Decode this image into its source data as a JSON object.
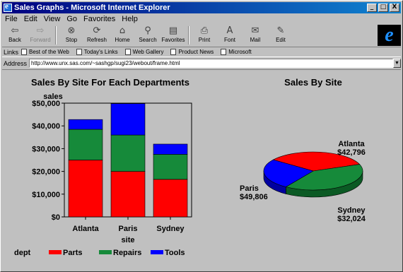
{
  "window": {
    "title": "Sales Graphs - Microsoft Internet Explorer",
    "minimize": "_",
    "maximize": "□",
    "close": "X"
  },
  "menu": [
    "File",
    "Edit",
    "View",
    "Go",
    "Favorites",
    "Help"
  ],
  "menu_access": [
    "F",
    "E",
    "V",
    "G",
    "a",
    "H"
  ],
  "toolbar": [
    {
      "label": "Back",
      "icon": "back-arrow-icon",
      "glyph": "⇦",
      "enabled": true
    },
    {
      "label": "Forward",
      "icon": "forward-arrow-icon",
      "glyph": "⇨",
      "enabled": false
    },
    {
      "label": "Stop",
      "icon": "stop-icon",
      "glyph": "⊗",
      "enabled": true
    },
    {
      "label": "Refresh",
      "icon": "refresh-icon",
      "glyph": "⟳",
      "enabled": true
    },
    {
      "label": "Home",
      "icon": "home-icon",
      "glyph": "⌂",
      "enabled": true
    },
    {
      "label": "Search",
      "icon": "search-icon",
      "glyph": "⚲",
      "enabled": true
    },
    {
      "label": "Favorites",
      "icon": "favorites-icon",
      "glyph": "▤",
      "enabled": true
    },
    {
      "label": "Print",
      "icon": "print-icon",
      "glyph": "⎙",
      "enabled": true
    },
    {
      "label": "Font",
      "icon": "font-icon",
      "glyph": "A",
      "enabled": true
    },
    {
      "label": "Mail",
      "icon": "mail-icon",
      "glyph": "✉",
      "enabled": true
    },
    {
      "label": "Edit",
      "icon": "edit-icon",
      "glyph": "✎",
      "enabled": true
    }
  ],
  "links": {
    "label": "Links",
    "items": [
      "Best of the Web",
      "Today's Links",
      "Web Gallery",
      "Product News",
      "Microsoft"
    ]
  },
  "address": {
    "label": "Address",
    "value": "http://www.unx.sas.com/~sashgp/sugi23/webout/frame.html"
  },
  "colors": {
    "parts": "#ff0000",
    "repairs": "#168a3a",
    "tools": "#0000ff"
  },
  "chart_data": [
    {
      "type": "bar",
      "title": "Sales By Site For Each Departments",
      "xlabel": "site",
      "ylabel": "sales",
      "categories": [
        "Atlanta",
        "Paris",
        "Sydney"
      ],
      "stacked": true,
      "ylim": [
        0,
        50000
      ],
      "yticks": [
        "$0",
        "$10,000",
        "$20,000",
        "$30,000",
        "$40,000",
        "$50,000"
      ],
      "ytick_values": [
        0,
        10000,
        20000,
        30000,
        40000,
        50000
      ],
      "series": [
        {
          "name": "Parts",
          "values": [
            25000,
            20000,
            16500
          ]
        },
        {
          "name": "Repairs",
          "values": [
            13500,
            16000,
            11000
          ]
        },
        {
          "name": "Tools",
          "values": [
            4300,
            13800,
            4500
          ]
        }
      ],
      "legend": {
        "title": "dept",
        "position": "bottom-left"
      }
    },
    {
      "type": "pie",
      "title": "Sales By Site",
      "categories": [
        "Atlanta",
        "Paris",
        "Sydney"
      ],
      "values": [
        42796,
        49806,
        32024
      ],
      "value_labels": [
        "$42,796",
        "$49,806",
        "$32,024"
      ],
      "colors": [
        "#ff0000",
        "#168a3a",
        "#0000ff"
      ]
    }
  ]
}
